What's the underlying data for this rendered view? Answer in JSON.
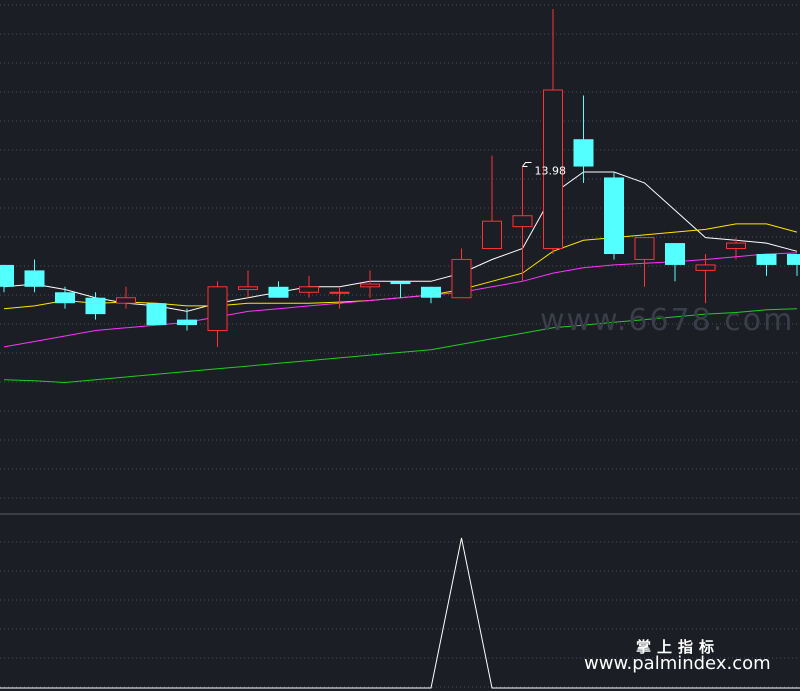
{
  "chart_data": [
    {
      "type": "candlestick",
      "price_range": [
        5.0,
        14.0
      ],
      "annotations": [
        {
          "text": "13.98",
          "candle_index": 17
        }
      ],
      "candles": [
        {
          "open": 9.3,
          "close": 8.9,
          "high": 9.3,
          "low": 8.8
        },
        {
          "open": 9.2,
          "close": 8.9,
          "high": 9.4,
          "low": 8.8
        },
        {
          "open": 8.8,
          "close": 8.6,
          "high": 8.9,
          "low": 8.5
        },
        {
          "open": 8.7,
          "close": 8.4,
          "high": 8.8,
          "low": 8.3
        },
        {
          "open": 8.6,
          "close": 8.7,
          "high": 8.9,
          "low": 8.5
        },
        {
          "open": 8.6,
          "close": 8.2,
          "high": 8.6,
          "low": 8.2
        },
        {
          "open": 8.3,
          "close": 8.2,
          "high": 8.5,
          "low": 8.1
        },
        {
          "open": 8.1,
          "close": 8.9,
          "high": 9.0,
          "low": 7.8
        },
        {
          "open": 8.85,
          "close": 8.9,
          "high": 9.2,
          "low": 8.7
        },
        {
          "open": 8.9,
          "close": 8.7,
          "high": 9.0,
          "low": 8.7
        },
        {
          "open": 8.8,
          "close": 8.9,
          "high": 9.1,
          "low": 8.7
        },
        {
          "open": 8.8,
          "close": 8.8,
          "high": 8.9,
          "low": 8.5
        },
        {
          "open": 8.9,
          "close": 8.95,
          "high": 9.2,
          "low": 8.7
        },
        {
          "open": 9.0,
          "close": 8.95,
          "high": 9.0,
          "low": 8.7
        },
        {
          "open": 8.9,
          "close": 8.7,
          "high": 8.9,
          "low": 8.6
        },
        {
          "open": 8.7,
          "close": 9.4,
          "high": 9.6,
          "low": 8.7
        },
        {
          "open": 9.6,
          "close": 10.1,
          "high": 11.3,
          "low": 9.6
        },
        {
          "open": 10.0,
          "close": 10.2,
          "high": 11.1,
          "low": 9.0
        },
        {
          "open": 9.6,
          "close": 12.5,
          "high": 13.98,
          "low": 9.5
        },
        {
          "open": 11.6,
          "close": 11.1,
          "high": 12.4,
          "low": 10.8
        },
        {
          "open": 10.9,
          "close": 9.5,
          "high": 11.0,
          "low": 9.4
        },
        {
          "open": 9.4,
          "close": 9.8,
          "high": 9.8,
          "low": 8.9
        },
        {
          "open": 9.7,
          "close": 9.3,
          "high": 9.7,
          "low": 9.0
        },
        {
          "open": 9.2,
          "close": 9.3,
          "high": 9.5,
          "low": 8.6
        },
        {
          "open": 9.6,
          "close": 9.7,
          "high": 9.8,
          "low": 9.4
        },
        {
          "open": 9.5,
          "close": 9.3,
          "high": 9.5,
          "low": 9.1
        },
        {
          "open": 9.5,
          "close": 9.3,
          "high": 9.5,
          "low": 9.1
        }
      ],
      "series": [
        {
          "color": "#ffffff",
          "values": [
            8.9,
            8.95,
            8.85,
            8.7,
            8.6,
            8.55,
            8.45,
            8.6,
            8.7,
            8.8,
            8.9,
            8.9,
            9.0,
            9.0,
            9.0,
            9.15,
            9.4,
            9.6,
            10.6,
            11.0,
            11.0,
            10.8,
            10.3,
            9.8,
            9.75,
            9.7,
            9.55
          ]
        },
        {
          "color": "#ffe600",
          "values": [
            8.5,
            8.55,
            8.65,
            8.6,
            8.62,
            8.6,
            8.55,
            8.55,
            8.6,
            8.6,
            8.6,
            8.62,
            8.65,
            8.7,
            8.75,
            8.85,
            9.0,
            9.15,
            9.55,
            9.75,
            9.8,
            9.85,
            9.9,
            9.95,
            10.05,
            10.05,
            9.9
          ]
        },
        {
          "color": "#ff33ff",
          "values": [
            7.8,
            7.9,
            8.0,
            8.1,
            8.15,
            8.2,
            8.25,
            8.35,
            8.45,
            8.5,
            8.55,
            8.6,
            8.65,
            8.7,
            8.75,
            8.8,
            8.9,
            9.0,
            9.15,
            9.25,
            9.3,
            9.33,
            9.36,
            9.4,
            9.45,
            9.5,
            9.52
          ]
        },
        {
          "color": "#22cc22",
          "values": [
            7.2,
            7.18,
            7.15,
            7.2,
            7.25,
            7.3,
            7.35,
            7.4,
            7.45,
            7.5,
            7.55,
            7.6,
            7.65,
            7.7,
            7.75,
            7.85,
            7.95,
            8.05,
            8.15,
            8.2,
            8.25,
            8.3,
            8.35,
            8.4,
            8.43,
            8.48,
            8.5
          ]
        }
      ]
    },
    {
      "type": "line",
      "color": "#ffffff",
      "values": [
        0,
        0,
        0,
        0,
        0,
        0,
        0,
        0,
        0,
        0,
        0,
        0,
        0,
        0,
        0,
        1,
        0,
        0,
        0,
        0,
        0,
        0,
        0,
        0,
        0,
        0,
        0
      ]
    }
  ],
  "colors": {
    "up": "#ff3333",
    "down": "#54ffff",
    "background": "#1c1e25",
    "grid": "#4a4f5c"
  },
  "watermarks": {
    "center": "www.6678.com",
    "brand_cn": "掌上指标",
    "brand_url": "www.palmindex.com"
  }
}
